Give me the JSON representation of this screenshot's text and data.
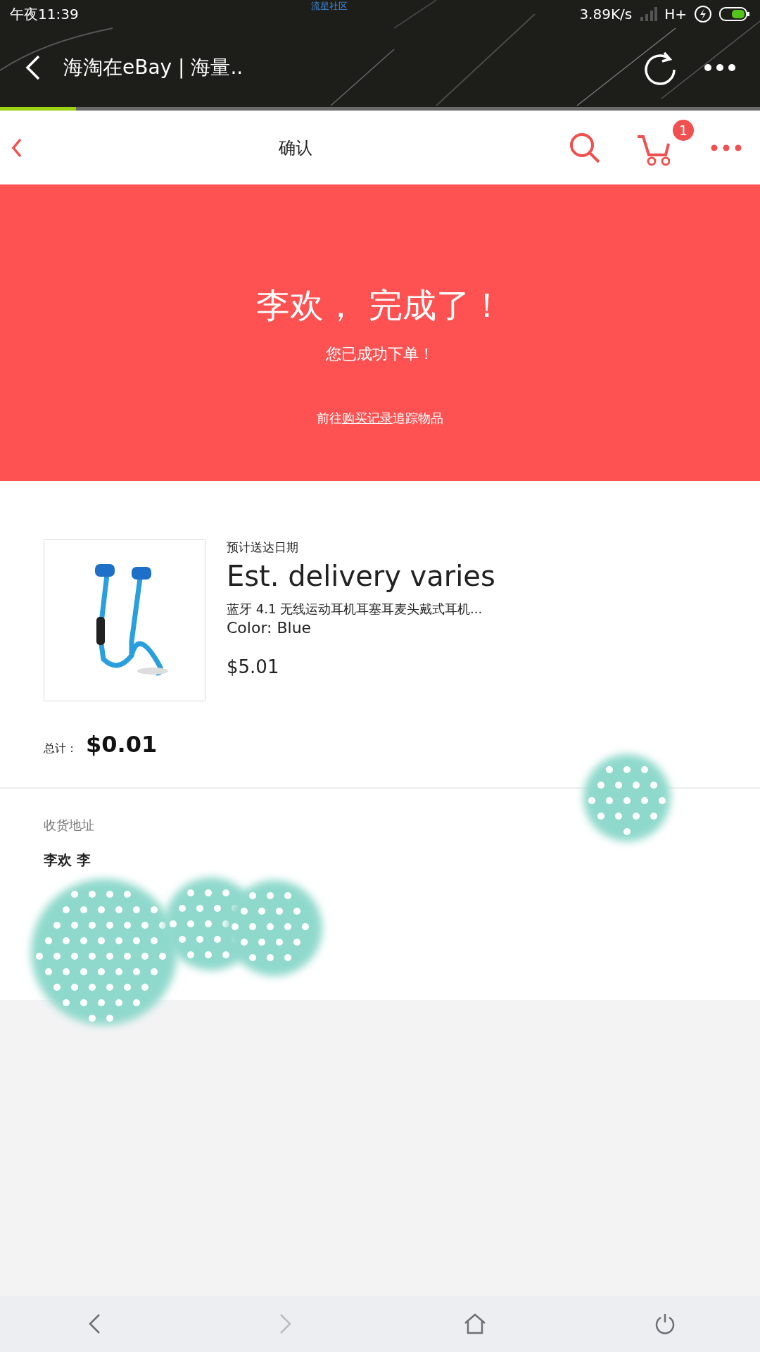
{
  "status_bar": {
    "time": "午夜11:39",
    "carrier_note": "流星社区",
    "speed": "3.89K/s",
    "network": "H+"
  },
  "browser": {
    "title": "海淘在eBay | 海量..",
    "load_progress": {
      "level": 0.1
    }
  },
  "header": {
    "title": "确认",
    "cart_count": "1"
  },
  "banner": {
    "heading": "李欢， 完成了！",
    "subheading": "您已成功下单！",
    "link_before": "前往",
    "link": "购买记录",
    "link_after": "追踪物品"
  },
  "order": {
    "delivery_label": "预计送达日期",
    "delivery": "Est. delivery varies",
    "item_title": "蓝牙 4.1 无线运动耳机耳塞耳麦头戴式耳机...",
    "variant": "Color: Blue",
    "price": "$5.01",
    "total_label": "总计：",
    "total": "$0.01"
  },
  "address": {
    "label": "收货地址",
    "name": "李欢 李"
  },
  "nav": [
    {
      "kind": "back",
      "disabled": false
    },
    {
      "kind": "forward",
      "disabled": true
    },
    {
      "kind": "home",
      "disabled": false
    },
    {
      "kind": "power",
      "disabled": false
    }
  ]
}
